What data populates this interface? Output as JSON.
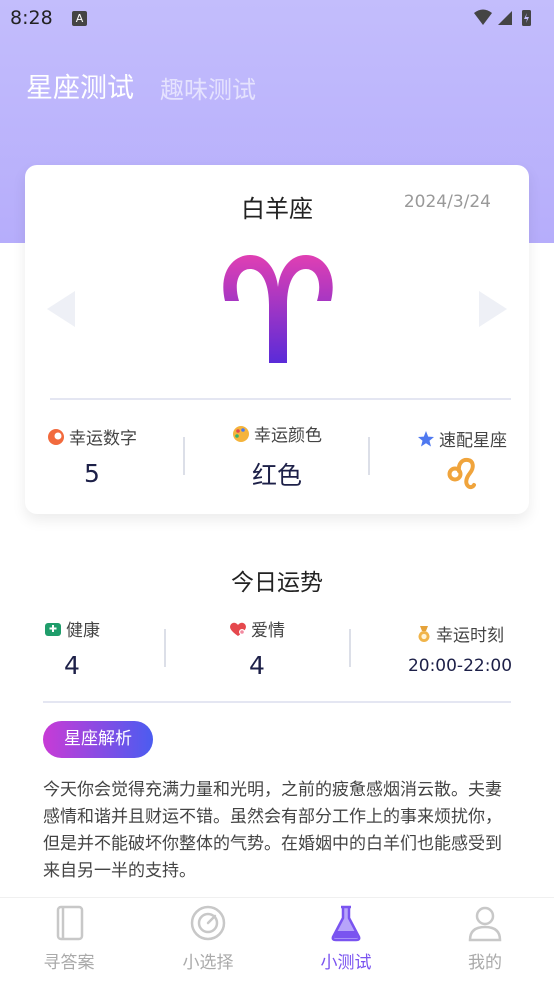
{
  "status_bar": {
    "time": "8:28",
    "notification_icon": "a-box-icon"
  },
  "header": {
    "tab_active": "星座测试",
    "tab_inactive": "趣味测试"
  },
  "sign_card": {
    "name": "白羊座",
    "date": "2024/3/24",
    "symbol_icon": "aries-icon",
    "lucky_number": {
      "label": "幸运数字",
      "value": "5",
      "icon": "flame-icon"
    },
    "lucky_color": {
      "label": "幸运颜色",
      "value": "红色",
      "icon": "palette-icon"
    },
    "match_sign": {
      "label": "速配星座",
      "icon": "leo-icon",
      "star_icon": "star-icon"
    }
  },
  "fortune": {
    "title": "今日运势",
    "health": {
      "label": "健康",
      "value": "4",
      "icon": "health-icon"
    },
    "love": {
      "label": "爱情",
      "value": "4",
      "icon": "heart-icon"
    },
    "lucky_time": {
      "label": "幸运时刻",
      "value": "20:00-22:00",
      "icon": "medal-icon"
    }
  },
  "analysis": {
    "badge": "星座解析",
    "text": "今天你会觉得充满力量和光明，之前的疲惫感烟消云散。夫妻感情和谐并且财运不错。虽然会有部分工作上的事来烦扰你，但是并不能破坏你整体的气势。在婚姻中的白羊们也能感受到来自另一半的支持。"
  },
  "bottom_nav": [
    {
      "label": "寻答案",
      "icon": "book-icon"
    },
    {
      "label": "小选择",
      "icon": "dial-icon"
    },
    {
      "label": "小测试",
      "icon": "flask-icon"
    },
    {
      "label": "我的",
      "icon": "user-icon"
    }
  ],
  "colors": {
    "accent": "#7a54f0",
    "hero_bg": "#c3bdfc",
    "aries_top": "#e03fb3",
    "aries_bottom": "#5a2bd8",
    "leo": "#f0a43c"
  }
}
